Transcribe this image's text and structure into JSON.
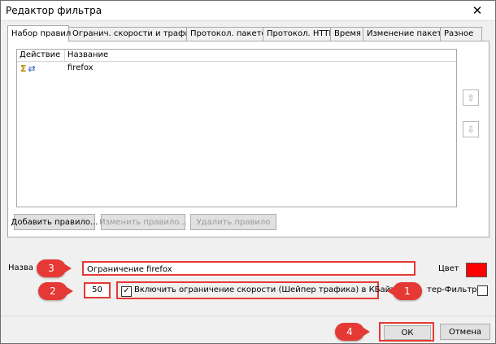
{
  "window": {
    "title": "Редактор фильтра",
    "close_glyph": "✕"
  },
  "tabs": [
    {
      "label": "Набор правил",
      "active": true
    },
    {
      "label": "Огранич. скорости и трафика"
    },
    {
      "label": "Протокол. пакетов"
    },
    {
      "label": "Протокол. HTTP"
    },
    {
      "label": "Время"
    },
    {
      "label": "Изменение пакетов"
    },
    {
      "label": "Разное"
    }
  ],
  "rules_list": {
    "columns": [
      "Действие",
      "Название"
    ],
    "rows": [
      {
        "action_icons": [
          "sigma-icon",
          "arrows-icon"
        ],
        "name": "firefox"
      }
    ]
  },
  "side_buttons": {
    "up_glyph": "⇧",
    "down_glyph": "⇩"
  },
  "rule_buttons": {
    "add": "Добавить правило...",
    "edit": "Изменить правило...",
    "delete": "Удалить правило"
  },
  "form": {
    "name_label": "Назва",
    "name_value": "Ограничение firefox",
    "color_label": "Цвет",
    "color_value": "#ff0000",
    "speed_value": "50",
    "shaper_label": "Включить ограничение скорости (Шейпер трафика) в КБайт/сек",
    "shaper_checked": "✓",
    "master_filter_label": "тер-Фильтр"
  },
  "callouts": {
    "one": "1",
    "two": "2",
    "three": "3",
    "four": "4"
  },
  "footer": {
    "ok_label": "ОК",
    "cancel_label": "Отмена"
  },
  "colors": {
    "callout": "#e53935",
    "window_bg": "#f0f0f0"
  }
}
